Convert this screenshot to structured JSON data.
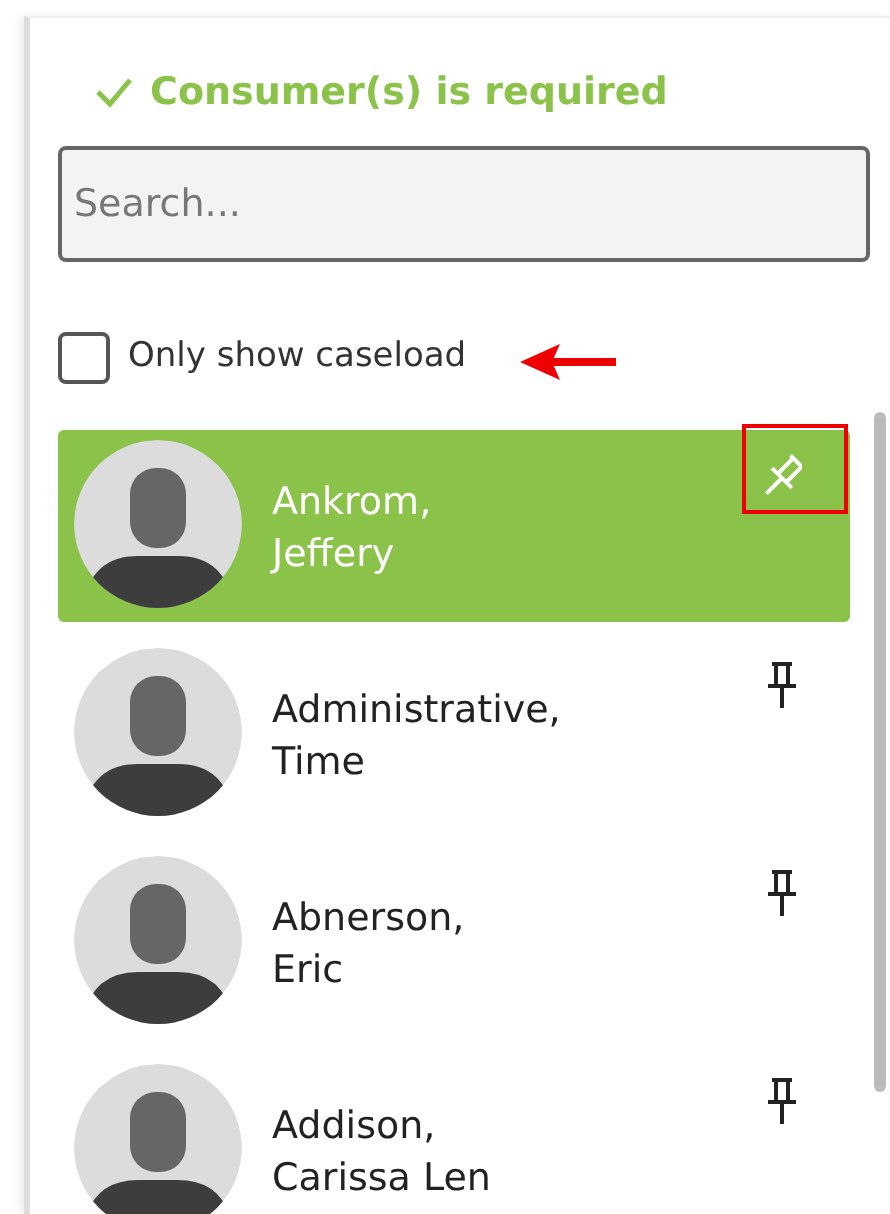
{
  "validation": {
    "text": "Consumer(s) is required",
    "valid": true
  },
  "search": {
    "placeholder": "Search..."
  },
  "caseload_filter": {
    "label": "Only show caseload",
    "checked": false
  },
  "consumers": [
    {
      "name": "Ankrom,\nJeffery",
      "selected": true
    },
    {
      "name": "Administrative,\nTime",
      "selected": false
    },
    {
      "name": "Abnerson,\nEric",
      "selected": false
    },
    {
      "name": "Addison,\nCarissa Len",
      "selected": false
    }
  ],
  "annotations": {
    "arrow": true,
    "box": true
  }
}
